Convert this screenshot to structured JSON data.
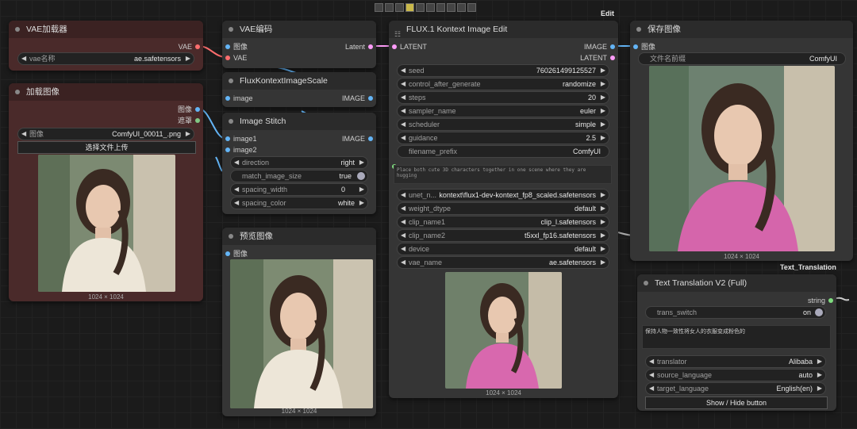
{
  "toolbar_icons": [
    "align-left-icon",
    "align-center-icon",
    "align-right-icon",
    "distribute-h-icon",
    "align-top-icon",
    "align-middle-icon",
    "align-bottom-icon",
    "distribute-v-icon",
    "same-width-icon",
    "same-height-icon"
  ],
  "tags": {
    "edit": "Edit",
    "text_translation": "Text_Translation"
  },
  "vae_loader": {
    "title": "VAE加载器",
    "out": "VAE",
    "w_label": "vae名称",
    "w_value": "ae.safetensors"
  },
  "load_image": {
    "title": "加载图像",
    "out1": "图像",
    "out2": "遮罩",
    "w_label": "图像",
    "w_value": "ComfyUI_00011_.png",
    "upload": "选择文件上传",
    "size": "1024 × 1024"
  },
  "vae_encode": {
    "title": "VAE编码",
    "in1": "图像",
    "in2": "VAE",
    "out": "Latent"
  },
  "flux_scale": {
    "title": "FluxKontextImageScale",
    "in": "image",
    "out": "IMAGE"
  },
  "stitch": {
    "title": "Image Stitch",
    "in1": "image1",
    "in2": "image2",
    "out": "IMAGE",
    "widgets": [
      {
        "label": "direction",
        "value": "right"
      },
      {
        "label": "match_image_size",
        "value": "true"
      },
      {
        "label": "spacing_width",
        "value": "0"
      },
      {
        "label": "spacing_color",
        "value": "white"
      }
    ]
  },
  "preview": {
    "title": "预览图像",
    "in": "图像",
    "size": "1024 × 1024"
  },
  "flux": {
    "title": "FLUX.1 Kontext Image Edit",
    "in": "LATENT",
    "out1": "IMAGE",
    "out2": "LATENT",
    "widgets": [
      {
        "label": "seed",
        "value": "760261499125527"
      },
      {
        "label": "control_after_generate",
        "value": "randomize"
      },
      {
        "label": "steps",
        "value": "20"
      },
      {
        "label": "sampler_name",
        "value": "euler"
      },
      {
        "label": "scheduler",
        "value": "simple"
      },
      {
        "label": "guidance",
        "value": "2.5"
      }
    ],
    "filename_label": "filename_prefix",
    "filename_value": "ComfyUI",
    "prompt": "Place both cute 3D characters together in one scene where they are hugging",
    "widgets2": [
      {
        "label": "unet_n...",
        "value": "kontext\\flux1-dev-kontext_fp8_scaled.safetensors"
      },
      {
        "label": "weight_dtype",
        "value": "default"
      },
      {
        "label": "clip_name1",
        "value": "clip_l.safetensors"
      },
      {
        "label": "clip_name2",
        "value": "t5xxl_fp16.safetensors"
      },
      {
        "label": "device",
        "value": "default"
      },
      {
        "label": "vae_name",
        "value": "ae.safetensors"
      }
    ],
    "size": "1024 × 1024"
  },
  "save": {
    "title": "保存图像",
    "in": "图像",
    "w_label": "文件名前缀",
    "w_value": "ComfyUI",
    "size": "1024 × 1024"
  },
  "translate": {
    "title": "Text Translation V2 (Full)",
    "out": "string",
    "switch_label": "trans_switch",
    "switch_value": "on",
    "text": "保持人物一致性将女人的衣服变成粉色的",
    "widgets": [
      {
        "label": "translator",
        "value": "Alibaba"
      },
      {
        "label": "source_language",
        "value": "auto"
      },
      {
        "label": "target_language",
        "value": "English(en)"
      }
    ],
    "button": "Show / Hide button"
  },
  "colors": {
    "image": "#64b5f6",
    "vae": "#ff6e6e",
    "latent": "#ff9cf9",
    "mask": "#81c784",
    "string": "#7fdc7f"
  }
}
